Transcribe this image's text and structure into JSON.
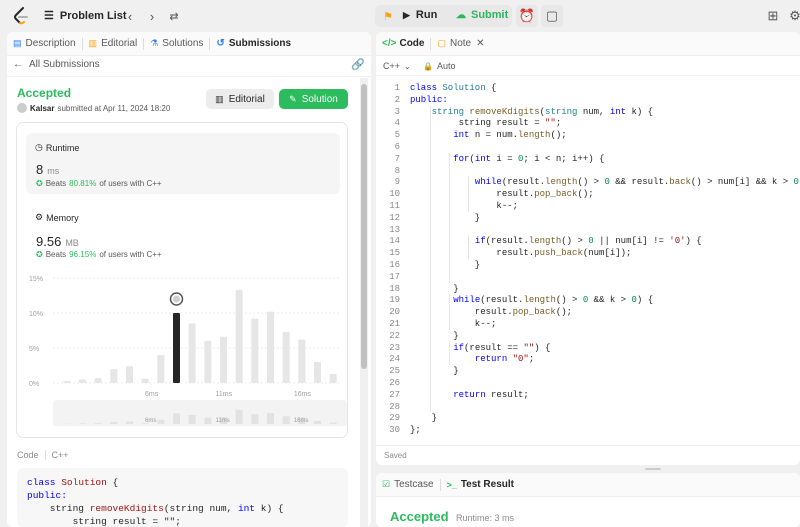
{
  "topbar": {
    "problem_list": "Problem List",
    "run": "Run",
    "submit": "Submit"
  },
  "left_tabs": [
    {
      "label": "Description"
    },
    {
      "label": "Editorial"
    },
    {
      "label": "Solutions"
    },
    {
      "label": "Submissions"
    }
  ],
  "submissions": {
    "back": "All Submissions",
    "status": "Accepted",
    "user": "Kalsar",
    "submitted_text": "submitted at Apr 11, 2024 18:20",
    "editorial_btn": "Editorial",
    "solution_btn": "Solution"
  },
  "runtime": {
    "title": "Runtime",
    "value": "8",
    "unit": "ms",
    "beats_prefix": "Beats",
    "beats_pct": "80.81%",
    "beats_suffix": "of users with C++"
  },
  "memory": {
    "title": "Memory",
    "value": "9.56",
    "unit": "MB",
    "beats_prefix": "Beats",
    "beats_pct": "96.15%",
    "beats_suffix": "of users with C++"
  },
  "chart_data": {
    "type": "bar",
    "yticks": [
      "15%",
      "10%",
      "5%",
      "0%"
    ],
    "xticks": [
      "6ms",
      "11ms",
      "16ms"
    ],
    "ylim": [
      0,
      15
    ],
    "values": [
      0.3,
      0.5,
      0.7,
      2,
      2.4,
      0.6,
      4,
      10,
      8.5,
      6,
      6.6,
      13.3,
      9.2,
      10.2,
      7.3,
      6.2,
      3,
      1.3
    ],
    "highlight_index": 7
  },
  "left_code": {
    "header_code": "Code",
    "header_lang": "C++",
    "lines": [
      [
        {
          "t": "class ",
          "c": "kw"
        },
        {
          "t": "Solution",
          "c": "ty"
        },
        {
          "t": " {",
          "c": ""
        }
      ],
      [
        {
          "t": "public:",
          "c": "kw"
        }
      ],
      [
        {
          "t": "    string ",
          "c": ""
        },
        {
          "t": "removeKdigits",
          "c": "fn"
        },
        {
          "t": "(string num, ",
          "c": ""
        },
        {
          "t": "int",
          "c": "kw"
        },
        {
          "t": " k) {",
          "c": ""
        }
      ],
      [
        {
          "t": "        string result = \"\";",
          "c": ""
        }
      ]
    ]
  },
  "code_panel": {
    "tab_code": "Code",
    "tab_note": "Note",
    "lang": "C++",
    "auto": "Auto",
    "saved": "Saved",
    "lines": [
      {
        "n": "1",
        "s": [
          {
            "t": "class ",
            "c": "kw"
          },
          {
            "t": "Solution",
            "c": "ty"
          },
          {
            "t": " {",
            "c": ""
          }
        ]
      },
      {
        "n": "2",
        "s": [
          {
            "t": "public:",
            "c": "kw"
          }
        ]
      },
      {
        "n": "3",
        "s": [
          {
            "t": "    string ",
            "c": "ty"
          },
          {
            "t": "removeKdigits",
            "c": "fn"
          },
          {
            "t": "(",
            "c": ""
          },
          {
            "t": "string",
            "c": "ty"
          },
          {
            "t": " num, ",
            "c": ""
          },
          {
            "t": "int",
            "c": "kw"
          },
          {
            "t": " k) {",
            "c": ""
          }
        ]
      },
      {
        "n": "4",
        "s": [
          {
            "t": "         string result = ",
            "c": ""
          },
          {
            "t": "\"\"",
            "c": "str"
          },
          {
            "t": ";",
            "c": ""
          }
        ]
      },
      {
        "n": "5",
        "s": [
          {
            "t": "        ",
            "c": ""
          },
          {
            "t": "int",
            "c": "kw"
          },
          {
            "t": " n = num.",
            "c": ""
          },
          {
            "t": "length",
            "c": "fn"
          },
          {
            "t": "();",
            "c": ""
          }
        ]
      },
      {
        "n": "6",
        "s": []
      },
      {
        "n": "7",
        "s": [
          {
            "t": "        ",
            "c": ""
          },
          {
            "t": "for",
            "c": "kw"
          },
          {
            "t": "(",
            "c": ""
          },
          {
            "t": "int",
            "c": "kw"
          },
          {
            "t": " i = ",
            "c": ""
          },
          {
            "t": "0",
            "c": "num"
          },
          {
            "t": "; i < n; i++) {",
            "c": ""
          }
        ]
      },
      {
        "n": "8",
        "s": []
      },
      {
        "n": "9",
        "s": [
          {
            "t": "            ",
            "c": ""
          },
          {
            "t": "while",
            "c": "kw"
          },
          {
            "t": "(result.",
            "c": ""
          },
          {
            "t": "length",
            "c": "fn"
          },
          {
            "t": "() > ",
            "c": ""
          },
          {
            "t": "0",
            "c": "num"
          },
          {
            "t": " && result.",
            "c": ""
          },
          {
            "t": "back",
            "c": "fn"
          },
          {
            "t": "() > num[i] && k > ",
            "c": ""
          },
          {
            "t": "0",
            "c": "num"
          },
          {
            "t": ") {",
            "c": ""
          }
        ]
      },
      {
        "n": "10",
        "s": [
          {
            "t": "                result.",
            "c": ""
          },
          {
            "t": "pop_back",
            "c": "fn"
          },
          {
            "t": "();",
            "c": ""
          }
        ]
      },
      {
        "n": "11",
        "s": [
          {
            "t": "                k--;",
            "c": ""
          }
        ]
      },
      {
        "n": "12",
        "s": [
          {
            "t": "            }",
            "c": ""
          }
        ]
      },
      {
        "n": "13",
        "s": []
      },
      {
        "n": "14",
        "s": [
          {
            "t": "            ",
            "c": ""
          },
          {
            "t": "if",
            "c": "kw"
          },
          {
            "t": "(result.",
            "c": ""
          },
          {
            "t": "length",
            "c": "fn"
          },
          {
            "t": "() > ",
            "c": ""
          },
          {
            "t": "0",
            "c": "num"
          },
          {
            "t": " || num[i] != ",
            "c": ""
          },
          {
            "t": "'0'",
            "c": "str"
          },
          {
            "t": ") {",
            "c": ""
          }
        ]
      },
      {
        "n": "15",
        "s": [
          {
            "t": "                result.",
            "c": ""
          },
          {
            "t": "push_back",
            "c": "fn"
          },
          {
            "t": "(num[i]);",
            "c": ""
          }
        ]
      },
      {
        "n": "16",
        "s": [
          {
            "t": "            }",
            "c": ""
          }
        ]
      },
      {
        "n": "17",
        "s": []
      },
      {
        "n": "18",
        "s": [
          {
            "t": "        }",
            "c": ""
          }
        ]
      },
      {
        "n": "19",
        "s": [
          {
            "t": "        ",
            "c": ""
          },
          {
            "t": "while",
            "c": "kw"
          },
          {
            "t": "(result.",
            "c": ""
          },
          {
            "t": "length",
            "c": "fn"
          },
          {
            "t": "() > ",
            "c": ""
          },
          {
            "t": "0",
            "c": "num"
          },
          {
            "t": " && k > ",
            "c": ""
          },
          {
            "t": "0",
            "c": "num"
          },
          {
            "t": ") {",
            "c": ""
          }
        ]
      },
      {
        "n": "20",
        "s": [
          {
            "t": "            result.",
            "c": ""
          },
          {
            "t": "pop_back",
            "c": "fn"
          },
          {
            "t": "();",
            "c": ""
          }
        ]
      },
      {
        "n": "21",
        "s": [
          {
            "t": "            k--;",
            "c": ""
          }
        ]
      },
      {
        "n": "22",
        "s": [
          {
            "t": "        }",
            "c": ""
          }
        ]
      },
      {
        "n": "23",
        "s": [
          {
            "t": "        ",
            "c": ""
          },
          {
            "t": "if",
            "c": "kw"
          },
          {
            "t": "(result == ",
            "c": ""
          },
          {
            "t": "\"\"",
            "c": "str"
          },
          {
            "t": ") {",
            "c": ""
          }
        ]
      },
      {
        "n": "24",
        "s": [
          {
            "t": "            ",
            "c": ""
          },
          {
            "t": "return",
            "c": "kw"
          },
          {
            "t": " ",
            "c": ""
          },
          {
            "t": "\"0\"",
            "c": "str"
          },
          {
            "t": ";",
            "c": ""
          }
        ]
      },
      {
        "n": "25",
        "s": [
          {
            "t": "        }",
            "c": ""
          }
        ]
      },
      {
        "n": "26",
        "s": []
      },
      {
        "n": "27",
        "s": [
          {
            "t": "        ",
            "c": ""
          },
          {
            "t": "return",
            "c": "kw"
          },
          {
            "t": " result;",
            "c": ""
          }
        ]
      },
      {
        "n": "28",
        "s": []
      },
      {
        "n": "29",
        "s": [
          {
            "t": "    }",
            "c": ""
          }
        ]
      },
      {
        "n": "30",
        "s": [
          {
            "t": "};",
            "c": ""
          }
        ]
      }
    ]
  },
  "test_panel": {
    "tab_testcase": "Testcase",
    "tab_result": "Test Result",
    "status": "Accepted",
    "runtime": "Runtime: 3 ms"
  },
  "colors": {
    "accent": "#2db55d",
    "orange": "#ffa116",
    "link": "#007aff",
    "accepted": "#2cbb5d"
  }
}
